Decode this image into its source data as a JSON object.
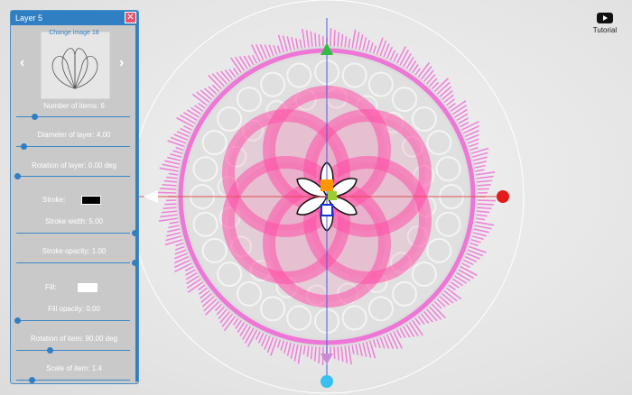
{
  "panel": {
    "title": "Layer 5",
    "image_title": "Change image 18",
    "items_label": "Number of items: 6",
    "diameter_label": "Diameter of layer: 4.00",
    "rotation_layer_label": "Rotation of layer: 0.00 deg",
    "stroke_label": "Stroke:",
    "stroke_color": "#000000",
    "stroke_width_label": "Stroke width: 5.00",
    "stroke_opacity_label": "Stroke opacity: 1.00",
    "fill_label": "Fill:",
    "fill_color": "#ffffff",
    "fill_opacity_label": "Fill opacity: 0.00",
    "rotation_item_label": "Rotation of item: 90.00 deg",
    "scale_label": "Scale of item: 1.4"
  },
  "tutorial": {
    "label": "Tutorial"
  },
  "colors": {
    "accent": "#2f7fc2",
    "magenta": "#f06ad6",
    "pink": "#ff4fa8"
  }
}
